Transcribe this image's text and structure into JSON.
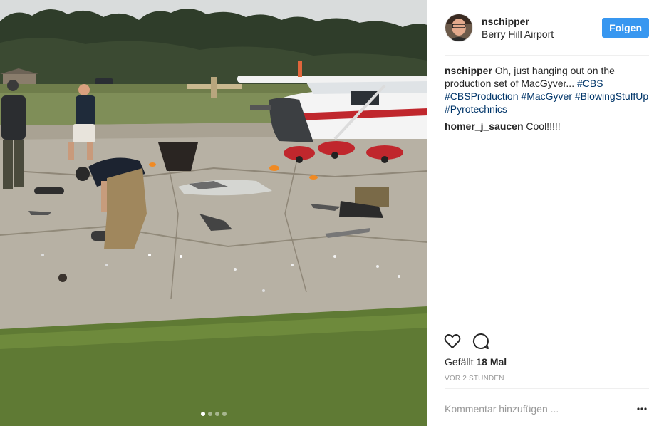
{
  "post": {
    "image_alt_icon": "photo-airfield-scene",
    "carousel": {
      "total": 4,
      "active_index": 0
    }
  },
  "header": {
    "username": "nschipper",
    "location": "Berry Hill Airport",
    "follow_label": "Folgen"
  },
  "comments": [
    {
      "author": "nschipper",
      "text": "Oh, just hanging out on the production set of MacGyver... ",
      "hashtags": [
        "#CBS",
        "#CBSProduction",
        "#MacGyver",
        "#BlowingStuffUp",
        "#Pyrotechnics"
      ]
    },
    {
      "author": "homer_j_saucen",
      "text": "Cool!!!!!",
      "hashtags": []
    }
  ],
  "actions": {
    "like_icon": "heart-icon",
    "comment_icon": "comment-icon"
  },
  "likes": {
    "prefix": "Gefällt",
    "count": "18 Mal"
  },
  "timestamp": "VOR 2 STUNDEN",
  "add_comment": {
    "placeholder": "Kommentar hinzufügen ...",
    "more_icon": "more-options-icon"
  },
  "colors": {
    "accent": "#3897f0",
    "hashtag": "#003569",
    "muted": "#999999"
  }
}
